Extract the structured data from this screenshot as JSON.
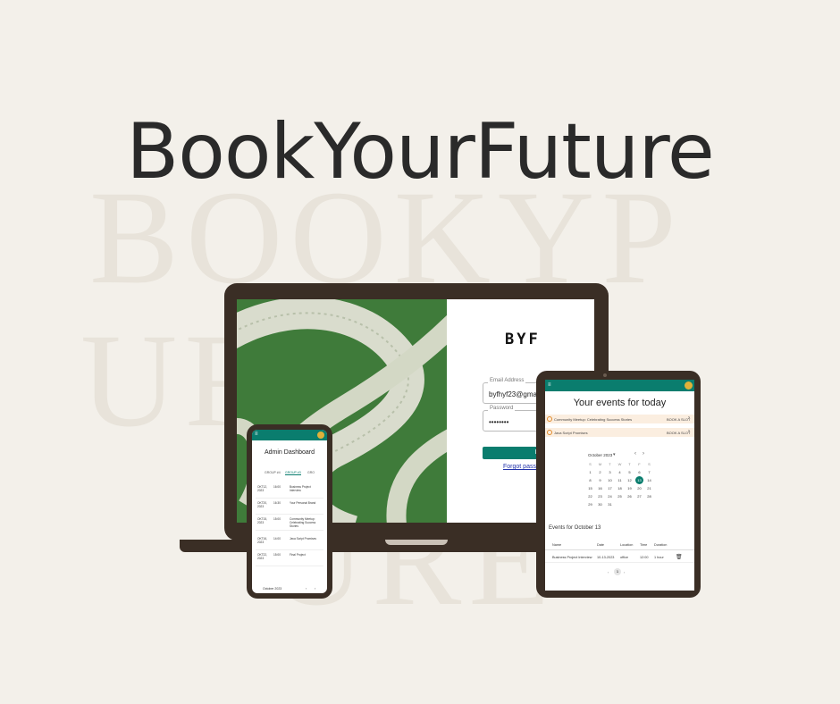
{
  "brand": {
    "title": "BookYourFuture",
    "watermark_line1": "BOOKYP",
    "watermark_line2": "URFU",
    "watermark_line3": "URE"
  },
  "login": {
    "logo": "BYF",
    "email_label": "Email Address",
    "email_value": "byfhyf23@gmail.com",
    "password_label": "Password",
    "password_value": "••••••••",
    "login_button": "LOGIN",
    "forgot_link": "Forgot password?"
  },
  "tablet": {
    "heading": "Your events for today",
    "events": [
      {
        "title": "Community Meetup: Celebrating Success Stories",
        "action": "BOOK A SLOT"
      },
      {
        "title": "Java Script Promises",
        "action": "BOOK A SLOT"
      }
    ],
    "calendar": {
      "month": "October 2023",
      "weekdays": [
        "S",
        "M",
        "T",
        "W",
        "T",
        "F",
        "S"
      ],
      "days": [
        "1",
        "2",
        "3",
        "4",
        "5",
        "6",
        "7",
        "8",
        "9",
        "10",
        "11",
        "12",
        "13",
        "14",
        "15",
        "16",
        "17",
        "18",
        "19",
        "20",
        "21",
        "22",
        "23",
        "24",
        "25",
        "26",
        "27",
        "28",
        "29",
        "30",
        "31"
      ],
      "selected_day": "13"
    },
    "events_for": "Events for October 13",
    "table_headers": [
      "Name",
      "Date",
      "Location",
      "Time",
      "Duration"
    ],
    "table_row": [
      "Business Project Interview",
      "10-13-2023",
      "office",
      "12:00",
      "1 hour"
    ],
    "pagination": [
      "‹",
      "1",
      "›"
    ]
  },
  "phone": {
    "heading": "Admin Dashboard",
    "tabs": [
      "GROUP #4",
      "GROUP #3",
      "GRO"
    ],
    "rows": [
      {
        "date": "OKT12, 2023",
        "time": "16:00",
        "title": "Business Project Interview"
      },
      {
        "date": "OKT20, 2023",
        "time": "16:30",
        "title": "Your Personal Brand"
      },
      {
        "date": "OKT15, 2023",
        "time": "15:00",
        "title": "Community Meetup: Celebrating Success Stories"
      },
      {
        "date": "OKT16, 2023",
        "time": "14:00",
        "title": "Java Script Promises"
      },
      {
        "date": "OKT22, 2023",
        "time": "15:00",
        "title": "Final Project"
      }
    ],
    "footer_month": "October 2023"
  },
  "colors": {
    "accent": "#0a7d6e",
    "device": "#3a2e25",
    "background": "#f3f0ea"
  }
}
